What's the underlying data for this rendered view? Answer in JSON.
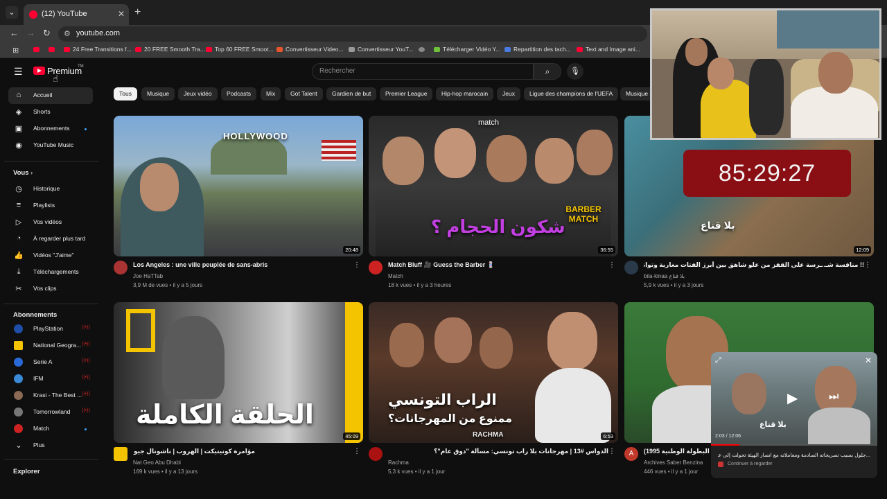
{
  "browser": {
    "tab_title": "(12) YouTube",
    "url": "youtube.com",
    "bookmarks": [
      "24 Free Transitions f...",
      "20 FREE Smooth Tra...",
      "Top 60 FREE Smoot...",
      "Convertisseur Video...",
      "Convertisseur YouT...",
      "Télécharger Vidéo Y...",
      "Repartition des tach...",
      "Text and Image ani..."
    ]
  },
  "header": {
    "logo_text": "Premium",
    "logo_tm": "TM",
    "search_placeholder": "Rechercher"
  },
  "sidebar": {
    "main": [
      {
        "label": "Accueil",
        "icon": "home-icon"
      },
      {
        "label": "Shorts",
        "icon": "shorts-icon"
      },
      {
        "label": "Abonnements",
        "icon": "subscriptions-icon"
      },
      {
        "label": "YouTube Music",
        "icon": "music-icon"
      }
    ],
    "you_header": "Vous",
    "you": [
      {
        "label": "Historique",
        "icon": "history-icon"
      },
      {
        "label": "Playlists",
        "icon": "playlists-icon"
      },
      {
        "label": "Vos vidéos",
        "icon": "your-videos-icon"
      },
      {
        "label": "À regarder plus tard",
        "icon": "watch-later-icon"
      },
      {
        "label": "Vidéos \"J'aime\"",
        "icon": "like-icon"
      },
      {
        "label": "Téléchargements",
        "icon": "download-icon"
      },
      {
        "label": "Vos clips",
        "icon": "clips-icon"
      }
    ],
    "subs_header": "Abonnements",
    "subscriptions": [
      {
        "label": "PlayStation",
        "color": "#1f4ea8"
      },
      {
        "label": "National Geogra...",
        "color": "#f5c400"
      },
      {
        "label": "Serie A",
        "color": "#2a6ad8"
      },
      {
        "label": "IFM",
        "color": "#3a8ad6"
      },
      {
        "label": "Krasi - The Best ...",
        "color": "#8a6a55"
      },
      {
        "label": "Tomorrowland",
        "color": "#777777"
      },
      {
        "label": "Match",
        "color": "#c22222"
      }
    ],
    "more_label": "Plus",
    "explore_header": "Explorer"
  },
  "chips": [
    "Tous",
    "Musique",
    "Jeux vidéo",
    "Podcasts",
    "Mix",
    "Got Talent",
    "Gardien de but",
    "Premier League",
    "Hip-hop marocain",
    "Jeux",
    "Ligue des champions de l'UEFA",
    "Musique a"
  ],
  "videos": [
    {
      "title": "Los Angeles : une ville peuplée de sans-abris",
      "channel": "Joe HaTTab",
      "meta": "3,9 M de vues • il y a 5 jours",
      "duration": "20:48",
      "overlay": "HOLLYWOOD"
    },
    {
      "title": "Match Bluff 🎥 Guess the Barber 💈",
      "channel": "Match",
      "meta": "18 k vues • il y a 3 heures",
      "duration": "36:55",
      "overlay": "شكون الحجام ؟",
      "overlay2": "BARBER MATCH",
      "overlay3": "match"
    },
    {
      "title": "!! مناقسة شـ..ـرسة على القفز من علو شاهق بين أبرز الفتات مغاربة وتوانسة..أولاد حي التضامن في الموعد",
      "channel": "bila-kinaa بلا قناع",
      "meta": "5,9 k vues • il y a 3 jours",
      "duration": "12:09",
      "overlay": "بلا قناع"
    },
    {
      "title": "مؤامرة كونيتيكت | الهروب | ناشونال جيوغرافيك أبوظبي",
      "channel": "Nat Geo Abu Dhabi",
      "meta": "169 k vues • il y a 13 jours",
      "duration": "45:09",
      "overlay": "الحلقة الكاملة"
    },
    {
      "title": "الدواس #13 | مهرجانات بلا راب تونسي: مسألة \"ذوق عام\"؟",
      "channel": "Rachma",
      "meta": "5,3 k vues • il y a 1 jour",
      "duration": "6:53",
      "overlay": "الراب التونسي",
      "overlay2": "ممنوع من المهرجانات؟",
      "overlay3": "RACHMA"
    },
    {
      "title": "ليس \"( البطولة الوطنية 1995)",
      "channel": "Archives Saber Benzina",
      "meta": "446 vues • il y a 1 jour",
      "duration": "",
      "overlay": ""
    }
  ],
  "timer": "85:29:27",
  "miniplayer": {
    "time": "2:03 / 12:06",
    "title": "...جلول بسبب تصريحاته الصادمة ومعاملاته مع انصار الهيئة تحولت إلى عنف",
    "continue_label": "Continuer à regarder",
    "watermark": "بلا قناع",
    "progress": 0.17
  }
}
